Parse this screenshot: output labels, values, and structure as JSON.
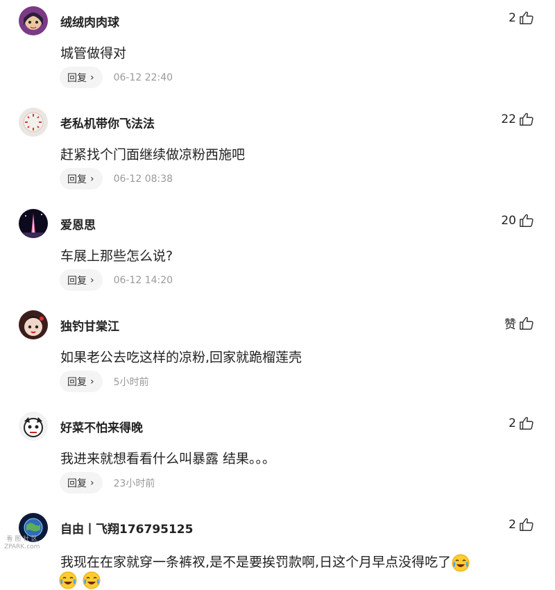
{
  "comments": [
    {
      "user": "绒绒肉肉球",
      "text": "城管做得对",
      "likes": "2",
      "reply": "回复",
      "time": "06-12 22:40"
    },
    {
      "user": "老私机带你飞法法",
      "text": "赶紧找个门面继续做凉粉西施吧",
      "likes": "22",
      "reply": "回复",
      "time": "06-12 08:38"
    },
    {
      "user": "爱恩思",
      "text": "车展上那些怎么说?",
      "likes": "20",
      "reply": "回复",
      "time": "06-12 14:20"
    },
    {
      "user": "独钓甘棠江",
      "text": "如果老公去吃这样的凉粉,回家就跪榴莲壳",
      "likes": "赞",
      "reply": "回复",
      "time": "5小时前"
    },
    {
      "user": "好菜不怕来得晚",
      "text": "我进来就想看看什么叫暴露 结果。。。",
      "likes": "2",
      "reply": "回复",
      "time": "23小时前"
    },
    {
      "user": "自由丨飞翔176795125",
      "text": "我现在在家就穿一条裤衩,是不是要挨罚款啊,日这个月早点没得吃了",
      "likes": "2"
    }
  ],
  "watermark": {
    "line1": "看 图 社 区",
    "line2": "ZPARK.com"
  },
  "icons": {
    "like": "thumbs-up-icon",
    "emoji": "crying-laughing-emoji"
  }
}
